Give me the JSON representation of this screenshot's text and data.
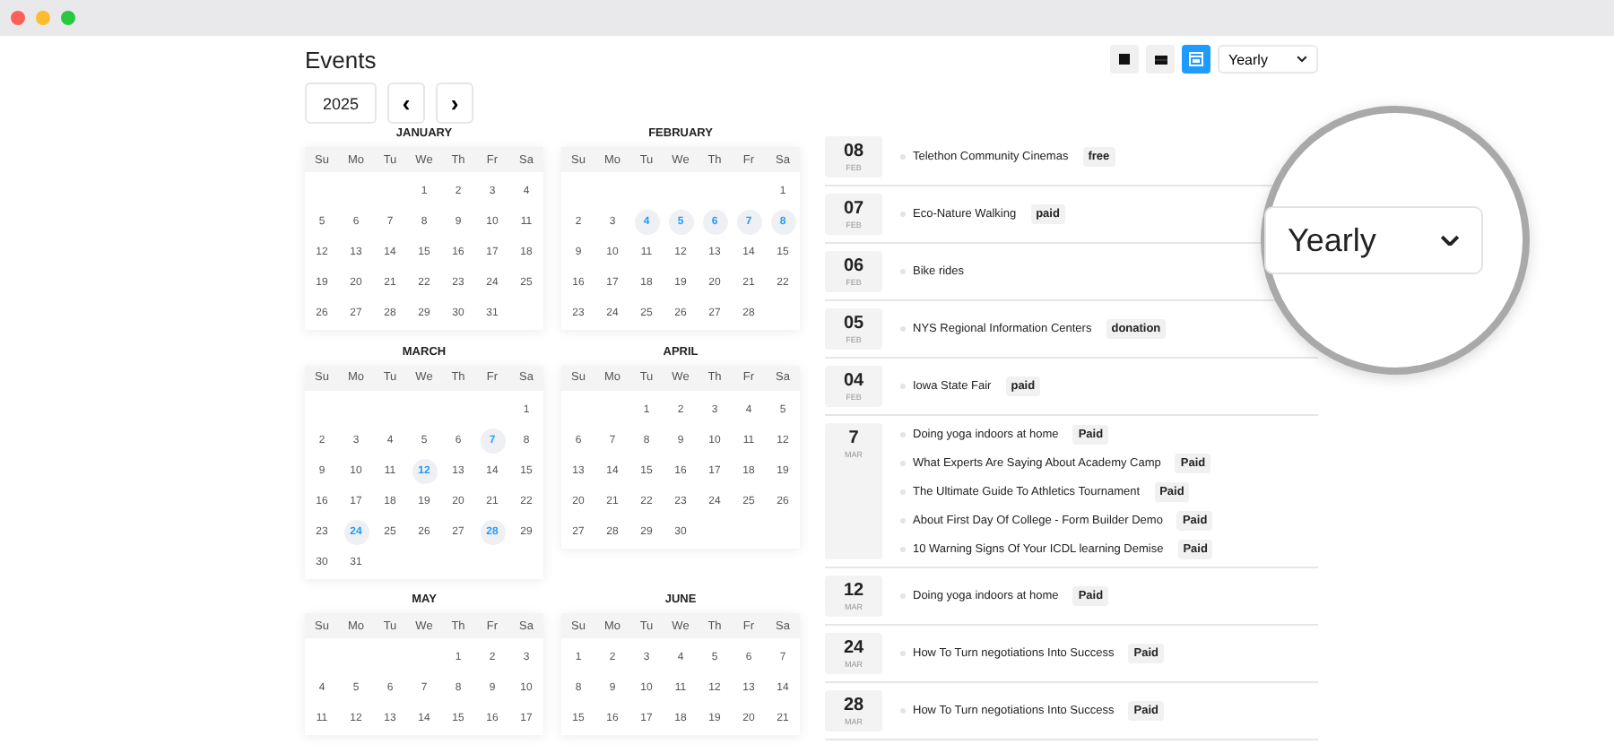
{
  "title": "Events",
  "year": "2025",
  "nav": [
    "‹",
    "›"
  ],
  "views": [
    {
      "kind": "square",
      "selected": false
    },
    {
      "kind": "list",
      "selected": false
    },
    {
      "kind": "calendar",
      "selected": true
    }
  ],
  "period": {
    "value": "Yearly"
  },
  "magnifier": {
    "value": "Yearly"
  },
  "calendars": [
    {
      "month": "JANUARY",
      "weekdays": [
        "Su",
        "Mo",
        "Tu",
        "We",
        "Th",
        "Fr",
        "Sa"
      ],
      "weeks": [
        [
          {
            "d": "1",
            "event": false
          },
          {
            "d": "2",
            "event": false
          },
          {
            "d": "3",
            "event": false
          },
          {
            "d": "4",
            "event": false
          }
        ],
        [
          {
            "d": "5",
            "event": false
          },
          {
            "d": "6",
            "event": false
          },
          {
            "d": "7",
            "event": false
          },
          {
            "d": "8",
            "event": false
          },
          {
            "d": "9",
            "event": false
          },
          {
            "d": "10",
            "event": false
          },
          {
            "d": "11",
            "event": false
          }
        ],
        [
          {
            "d": "12",
            "event": false
          },
          {
            "d": "13",
            "event": false
          },
          {
            "d": "14",
            "event": false
          },
          {
            "d": "15",
            "event": false
          },
          {
            "d": "16",
            "event": false
          },
          {
            "d": "17",
            "event": false
          },
          {
            "d": "18",
            "event": false
          }
        ],
        [
          {
            "d": "19",
            "event": false
          },
          {
            "d": "20",
            "event": false
          },
          {
            "d": "21",
            "event": false
          },
          {
            "d": "22",
            "event": false
          },
          {
            "d": "23",
            "event": false
          },
          {
            "d": "24",
            "event": false
          },
          {
            "d": "25",
            "event": false
          }
        ],
        [
          {
            "d": "26",
            "event": false
          },
          {
            "d": "27",
            "event": false
          },
          {
            "d": "28",
            "event": false
          },
          {
            "d": "29",
            "event": false
          },
          {
            "d": "30",
            "event": false
          },
          {
            "d": "31",
            "event": false
          }
        ]
      ]
    },
    {
      "month": "FEBRUARY",
      "weekdays": [
        "Su",
        "Mo",
        "Tu",
        "We",
        "Th",
        "Fr",
        "Sa"
      ],
      "weeks": [
        [
          {
            "d": "1",
            "event": false
          }
        ],
        [
          {
            "d": "2",
            "event": false
          },
          {
            "d": "3",
            "event": false
          },
          {
            "d": "4",
            "event": true
          },
          {
            "d": "5",
            "event": true
          },
          {
            "d": "6",
            "event": true
          },
          {
            "d": "7",
            "event": true
          },
          {
            "d": "8",
            "event": true
          }
        ],
        [
          {
            "d": "9",
            "event": false
          },
          {
            "d": "10",
            "event": false
          },
          {
            "d": "11",
            "event": false
          },
          {
            "d": "12",
            "event": false
          },
          {
            "d": "13",
            "event": false
          },
          {
            "d": "14",
            "event": false
          },
          {
            "d": "15",
            "event": false
          }
        ],
        [
          {
            "d": "16",
            "event": false
          },
          {
            "d": "17",
            "event": false
          },
          {
            "d": "18",
            "event": false
          },
          {
            "d": "19",
            "event": false
          },
          {
            "d": "20",
            "event": false
          },
          {
            "d": "21",
            "event": false
          },
          {
            "d": "22",
            "event": false
          }
        ],
        [
          {
            "d": "23",
            "event": false
          },
          {
            "d": "24",
            "event": false
          },
          {
            "d": "25",
            "event": false
          },
          {
            "d": "26",
            "event": false
          },
          {
            "d": "27",
            "event": false
          },
          {
            "d": "28",
            "event": false
          }
        ]
      ]
    },
    {
      "month": "MARCH",
      "weekdays": [
        "Su",
        "Mo",
        "Tu",
        "We",
        "Th",
        "Fr",
        "Sa"
      ],
      "weeks": [
        [
          {
            "d": "1",
            "event": false
          }
        ],
        [
          {
            "d": "2",
            "event": false
          },
          {
            "d": "3",
            "event": false
          },
          {
            "d": "4",
            "event": false
          },
          {
            "d": "5",
            "event": false
          },
          {
            "d": "6",
            "event": false
          },
          {
            "d": "7",
            "event": true
          },
          {
            "d": "8",
            "event": false
          }
        ],
        [
          {
            "d": "9",
            "event": false
          },
          {
            "d": "10",
            "event": false
          },
          {
            "d": "11",
            "event": false
          },
          {
            "d": "12",
            "event": true
          },
          {
            "d": "13",
            "event": false
          },
          {
            "d": "14",
            "event": false
          },
          {
            "d": "15",
            "event": false
          }
        ],
        [
          {
            "d": "16",
            "event": false
          },
          {
            "d": "17",
            "event": false
          },
          {
            "d": "18",
            "event": false
          },
          {
            "d": "19",
            "event": false
          },
          {
            "d": "20",
            "event": false
          },
          {
            "d": "21",
            "event": false
          },
          {
            "d": "22",
            "event": false
          }
        ],
        [
          {
            "d": "23",
            "event": false
          },
          {
            "d": "24",
            "event": true
          },
          {
            "d": "25",
            "event": false
          },
          {
            "d": "26",
            "event": false
          },
          {
            "d": "27",
            "event": false
          },
          {
            "d": "28",
            "event": true
          },
          {
            "d": "29",
            "event": false
          }
        ],
        [
          {
            "d": "30",
            "event": false
          },
          {
            "d": "31",
            "event": false
          }
        ]
      ]
    },
    {
      "month": "APRIL",
      "weekdays": [
        "Su",
        "Mo",
        "Tu",
        "We",
        "Th",
        "Fr",
        "Sa"
      ],
      "weeks": [
        [
          {
            "d": "1",
            "event": false
          },
          {
            "d": "2",
            "event": false
          },
          {
            "d": "3",
            "event": false
          },
          {
            "d": "4",
            "event": false
          },
          {
            "d": "5",
            "event": false
          }
        ],
        [
          {
            "d": "6",
            "event": false
          },
          {
            "d": "7",
            "event": false
          },
          {
            "d": "8",
            "event": false
          },
          {
            "d": "9",
            "event": false
          },
          {
            "d": "10",
            "event": false
          },
          {
            "d": "11",
            "event": false
          },
          {
            "d": "12",
            "event": false
          }
        ],
        [
          {
            "d": "13",
            "event": false
          },
          {
            "d": "14",
            "event": false
          },
          {
            "d": "15",
            "event": false
          },
          {
            "d": "16",
            "event": false
          },
          {
            "d": "17",
            "event": false
          },
          {
            "d": "18",
            "event": false
          },
          {
            "d": "19",
            "event": false
          }
        ],
        [
          {
            "d": "20",
            "event": false
          },
          {
            "d": "21",
            "event": false
          },
          {
            "d": "22",
            "event": false
          },
          {
            "d": "23",
            "event": false
          },
          {
            "d": "24",
            "event": false
          },
          {
            "d": "25",
            "event": false
          },
          {
            "d": "26",
            "event": false
          }
        ],
        [
          {
            "d": "27",
            "event": false
          },
          {
            "d": "28",
            "event": false
          },
          {
            "d": "29",
            "event": false
          },
          {
            "d": "30",
            "event": false
          }
        ]
      ]
    },
    {
      "month": "MAY",
      "weekdays": [
        "Su",
        "Mo",
        "Tu",
        "We",
        "Th",
        "Fr",
        "Sa"
      ],
      "weeks": [
        [
          {
            "d": "1",
            "event": false
          },
          {
            "d": "2",
            "event": false
          },
          {
            "d": "3",
            "event": false
          }
        ],
        [
          {
            "d": "4",
            "event": false
          },
          {
            "d": "5",
            "event": false
          },
          {
            "d": "6",
            "event": false
          },
          {
            "d": "7",
            "event": false
          },
          {
            "d": "8",
            "event": false
          },
          {
            "d": "9",
            "event": false
          },
          {
            "d": "10",
            "event": false
          }
        ],
        [
          {
            "d": "11",
            "event": false
          },
          {
            "d": "12",
            "event": false
          },
          {
            "d": "13",
            "event": false
          },
          {
            "d": "14",
            "event": false
          },
          {
            "d": "15",
            "event": false
          },
          {
            "d": "16",
            "event": false
          },
          {
            "d": "17",
            "event": false
          }
        ]
      ]
    },
    {
      "month": "JUNE",
      "weekdays": [
        "Su",
        "Mo",
        "Tu",
        "We",
        "Th",
        "Fr",
        "Sa"
      ],
      "weeks": [
        [
          {
            "d": "1",
            "event": false
          },
          {
            "d": "2",
            "event": false
          },
          {
            "d": "3",
            "event": false
          },
          {
            "d": "4",
            "event": false
          },
          {
            "d": "5",
            "event": false
          },
          {
            "d": "6",
            "event": false
          },
          {
            "d": "7",
            "event": false
          }
        ],
        [
          {
            "d": "8",
            "event": false
          },
          {
            "d": "9",
            "event": false
          },
          {
            "d": "10",
            "event": false
          },
          {
            "d": "11",
            "event": false
          },
          {
            "d": "12",
            "event": false
          },
          {
            "d": "13",
            "event": false
          },
          {
            "d": "14",
            "event": false
          }
        ],
        [
          {
            "d": "15",
            "event": false
          },
          {
            "d": "16",
            "event": false
          },
          {
            "d": "17",
            "event": false
          },
          {
            "d": "18",
            "event": false
          },
          {
            "d": "19",
            "event": false
          },
          {
            "d": "20",
            "event": false
          },
          {
            "d": "21",
            "event": false
          }
        ]
      ]
    }
  ],
  "events": [
    {
      "day": "08",
      "month": "FEB",
      "items": [
        {
          "title": "Telethon Community Cinemas",
          "tag": "free"
        }
      ]
    },
    {
      "day": "07",
      "month": "FEB",
      "items": [
        {
          "title": "Eco-Nature Walking",
          "tag": "paid"
        }
      ]
    },
    {
      "day": "06",
      "month": "FEB",
      "items": [
        {
          "title": "Bike rides"
        }
      ]
    },
    {
      "day": "05",
      "month": "FEB",
      "items": [
        {
          "title": "NYS Regional Information Centers",
          "tag": "donation"
        }
      ]
    },
    {
      "day": "04",
      "month": "FEB",
      "items": [
        {
          "title": "Iowa State Fair",
          "tag": "paid"
        }
      ]
    },
    {
      "day": "7",
      "month": "MAR",
      "items": [
        {
          "title": "Doing yoga indoors at home",
          "tag": "Paid"
        },
        {
          "title": "What Experts Are Saying About Academy Camp",
          "tag": "Paid"
        },
        {
          "title": "The Ultimate Guide To Athletics Tournament",
          "tag": "Paid"
        },
        {
          "title": "About First Day Of College - Form Builder Demo",
          "tag": "Paid"
        },
        {
          "title": "10 Warning Signs Of Your ICDL learning Demise",
          "tag": "Paid"
        }
      ]
    },
    {
      "day": "12",
      "month": "MAR",
      "items": [
        {
          "title": "Doing yoga indoors at home",
          "tag": "Paid"
        }
      ]
    },
    {
      "day": "24",
      "month": "MAR",
      "items": [
        {
          "title": "How To Turn negotiations Into Success",
          "tag": "Paid"
        }
      ]
    },
    {
      "day": "28",
      "month": "MAR",
      "items": [
        {
          "title": "How To Turn negotiations Into Success",
          "tag": "Paid"
        }
      ]
    }
  ]
}
